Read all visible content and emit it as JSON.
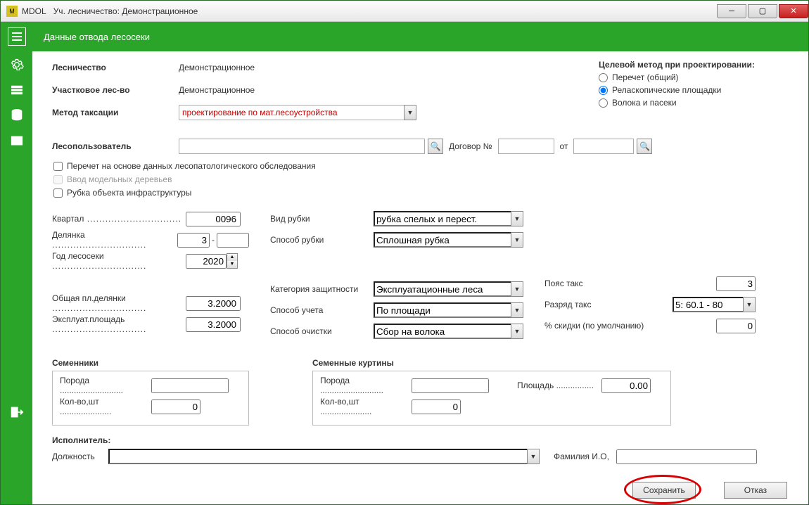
{
  "titlebar": {
    "app": "MDOL",
    "subtitle": "Уч. лесничество: Демонстрационное"
  },
  "header": {
    "title": "Данные отвода лесосеки"
  },
  "top": {
    "forestry_lbl": "Лесничество",
    "forestry_val": "Демонстрационное",
    "district_lbl": "Участковое лес-во",
    "district_val": "Демонстрационное",
    "method_lbl": "Метод таксации",
    "method_val": "проектирование по мат.лесоустройства"
  },
  "target": {
    "title": "Целевой метод при проектировании:",
    "opt1": "Перечет (общий)",
    "opt2": "Реласкопические площадки",
    "opt3": "Волока и пасеки",
    "selected": 1
  },
  "user": {
    "lbl": "Лесопользователь",
    "val": "",
    "contract_lbl": "Договор №",
    "contract_val": "",
    "from_lbl": "от",
    "from_val": ""
  },
  "checks": {
    "c1": "Перечет на основе данных лесопатологического обследования",
    "c2": "Ввод модельных деревьев",
    "c3": "Рубка объекта инфраструктуры"
  },
  "left": {
    "kvartal_lbl": "Квартал",
    "kvartal_val": "0096",
    "delyanka_lbl": "Делянка",
    "delyanka_val": "3",
    "delyanka_suf": "",
    "year_lbl": "Год лесосеки",
    "year_val": "2020",
    "totalarea_lbl": "Общая пл.делянки",
    "totalarea_val": "3.2000",
    "exparea_lbl": "Эксплуат.площадь",
    "exparea_val": "3.2000"
  },
  "mid": {
    "cuttype_lbl": "Вид рубки",
    "cuttype_val": "рубка спелых и перест.",
    "cutmethod_lbl": "Способ рубки",
    "cutmethod_val": "Сплошная рубка",
    "protcat_lbl": "Категория защитности",
    "protcat_val": "Эксплуатационные леса",
    "account_lbl": "Способ учета",
    "account_val": "По площади",
    "clean_lbl": "Способ очистки",
    "clean_val": "Сбор на волока"
  },
  "right": {
    "taxzone_lbl": "Пояс такс",
    "taxzone_val": "3",
    "taxrank_lbl": "Разряд такс",
    "taxrank_val": "5: 60.1 - 80",
    "discount_lbl": "% скидки (по умолчанию)",
    "discount_val": "0"
  },
  "seed": {
    "title": "Семенники",
    "breed_lbl": "Порода",
    "breed_val": "",
    "qty_lbl": "Кол-во,шт",
    "qty_val": "0"
  },
  "curtain": {
    "title": "Семенные куртины",
    "breed_lbl": "Порода",
    "breed_val": "",
    "qty_lbl": "Кол-во,шт",
    "qty_val": "0",
    "area_lbl": "Площадь",
    "area_val": "0.00"
  },
  "executor": {
    "title": "Исполнитель:",
    "pos_lbl": "Должность",
    "pos_val": "",
    "name_lbl": "Фамилия И.О,",
    "name_val": ""
  },
  "buttons": {
    "save": "Сохранить",
    "cancel": "Отказ"
  }
}
